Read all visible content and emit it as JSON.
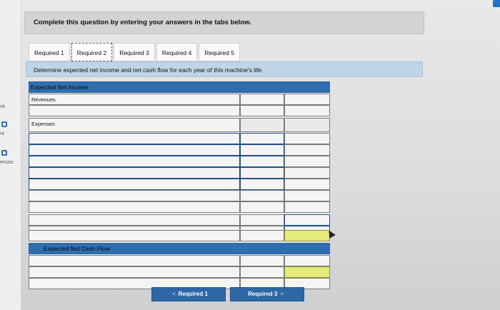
{
  "sidebar": {
    "items": [
      {
        "label": "ok",
        "icon": "book-icon"
      },
      {
        "label": "nt",
        "icon": "print-icon"
      },
      {
        "label": "ences",
        "icon": "references-icon"
      }
    ]
  },
  "question": {
    "instruction": "Complete this question by entering your answers in the tabs below."
  },
  "tabs": [
    {
      "label": "Required 1",
      "active": false
    },
    {
      "label": "Required 2",
      "active": true
    },
    {
      "label": "Required 3",
      "active": false
    },
    {
      "label": "Required 4",
      "active": false
    },
    {
      "label": "Required 5",
      "active": false
    }
  ],
  "task": {
    "prompt": "Determine expected net income and net cash flow for each year of this machine's life."
  },
  "table": {
    "net_income_header": "Expected Net Income",
    "revenues_label": "Revenues",
    "expenses_label": "Expenses",
    "cash_flow_header": "Expected Net Cash Flow"
  },
  "nav": {
    "prev_label": "Required 1",
    "next_label": "Required 3",
    "prev_chevron": "<",
    "next_chevron": ">"
  },
  "colors": {
    "header_blue": "#2f6fb0",
    "highlight_yellow": "#e5eb7c",
    "button_blue": "#2e67a6"
  }
}
